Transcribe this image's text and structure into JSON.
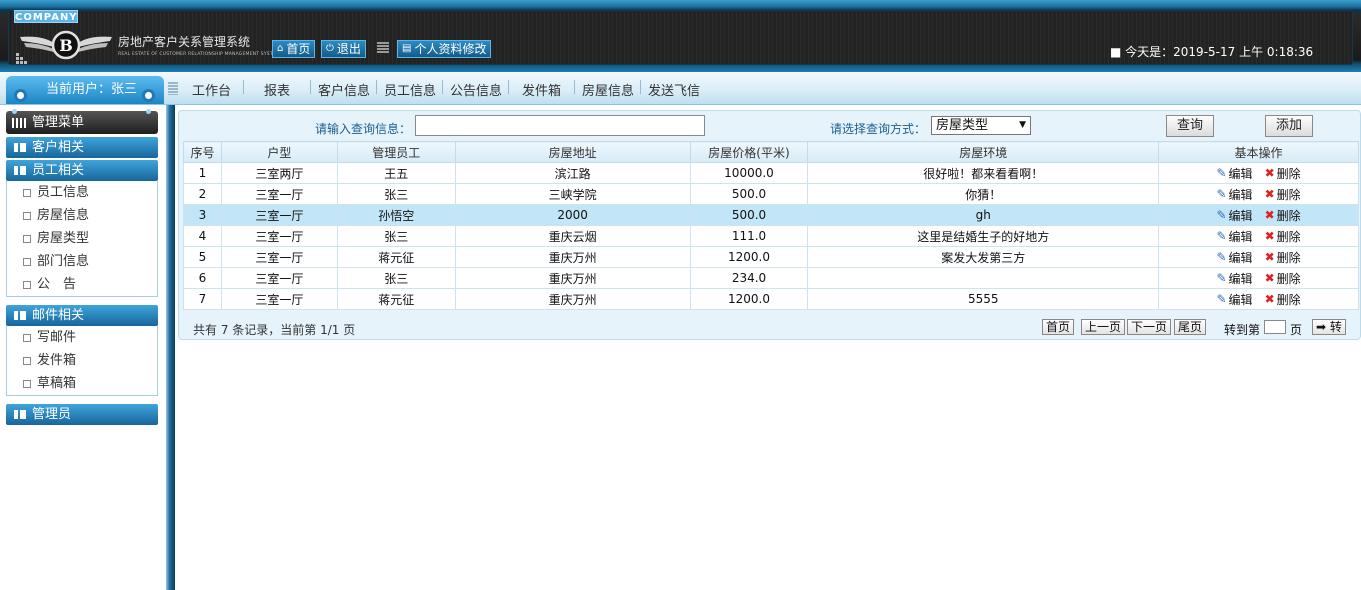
{
  "header": {
    "company": "COMPANY",
    "system_title": "房地产客户关系管理系统",
    "system_subtitle": "REAL ESTATE OF CUSTOMER RELATIONSHIP MANAGEMENT SYSTEM",
    "home_label": "首页",
    "logout_label": "退出",
    "profile_label": "个人资料修改",
    "date_text": "■ 今天是：2019-5-17 上午 0:18:36"
  },
  "navbar": {
    "current_user": "当前用户：张三",
    "items": [
      "工作台",
      "报表",
      "客户信息",
      "员工信息",
      "公告信息",
      "发件箱",
      "房屋信息",
      "发送飞信"
    ]
  },
  "sidebar": {
    "menu_title": "管理菜单",
    "groups": [
      {
        "label": "客户相关",
        "items": []
      },
      {
        "label": "员工相关",
        "items": [
          "员工信息",
          "房屋信息",
          "房屋类型",
          "部门信息",
          "公　告"
        ]
      },
      {
        "label": "邮件相关",
        "items": [
          "写邮件",
          "发件箱",
          "草稿箱"
        ]
      },
      {
        "label": "管理员",
        "items": []
      }
    ]
  },
  "query": {
    "input_label": "请输入查询信息：",
    "input_value": "",
    "select_label": "请选择查询方式：",
    "select_value": "房屋类型",
    "search_button": "查询",
    "add_button": "添加"
  },
  "table": {
    "headers": [
      "序号",
      "户型",
      "管理员工",
      "房屋地址",
      "房屋价格(平米)",
      "房屋环境",
      "基本操作"
    ],
    "edit_label": "编辑",
    "delete_label": "删除",
    "selected_row": 2,
    "rows": [
      [
        "1",
        "三室两厅",
        "王五",
        "滨江路",
        "10000.0",
        "很好啦！都来看看啊！"
      ],
      [
        "2",
        "三室一厅",
        "张三",
        "三峡学院",
        "500.0",
        "你猜！"
      ],
      [
        "3",
        "三室一厅",
        "孙悟空",
        "2000",
        "500.0",
        "gh"
      ],
      [
        "4",
        "三室一厅",
        "张三",
        "重庆云烟",
        "111.0",
        "这里是结婚生子的好地方"
      ],
      [
        "5",
        "三室一厅",
        "蒋元征",
        "重庆万州",
        "1200.0",
        "案发大发第三方"
      ],
      [
        "6",
        "三室一厅",
        "张三",
        "重庆万州",
        "234.0",
        ""
      ],
      [
        "7",
        "三室一厅",
        "蒋元征",
        "重庆万州",
        "1200.0",
        "5555"
      ]
    ]
  },
  "pagination": {
    "summary": "共有 7 条记录，当前第 1/1 页",
    "first": "首页",
    "prev": "上一页",
    "next": "下一页",
    "last": "尾页",
    "goto_prefix": "转到第",
    "goto_suffix": "页",
    "goto_button": "➡ 转"
  }
}
